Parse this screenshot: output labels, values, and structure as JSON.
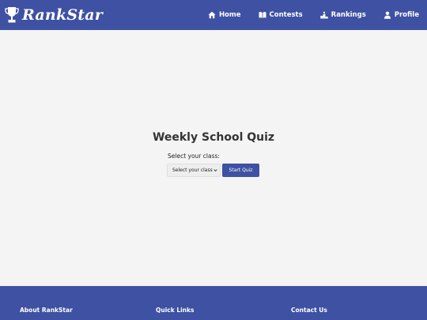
{
  "header": {
    "brand": "RankStar",
    "nav": [
      {
        "label": "Home",
        "icon": "home-icon"
      },
      {
        "label": "Contests",
        "icon": "book-icon"
      },
      {
        "label": "Rankings",
        "icon": "podium-icon"
      },
      {
        "label": "Profile",
        "icon": "user-icon"
      }
    ]
  },
  "main": {
    "title": "Weekly School Quiz",
    "select_label": "Select your class:",
    "select_value": "Select your class",
    "start_button": "Start Quiz"
  },
  "footer": {
    "about": "About RankStar",
    "links": "Quick Links",
    "contact": "Contact Us"
  },
  "colors": {
    "primary": "#3f51a3",
    "background": "#f4f4f4"
  }
}
